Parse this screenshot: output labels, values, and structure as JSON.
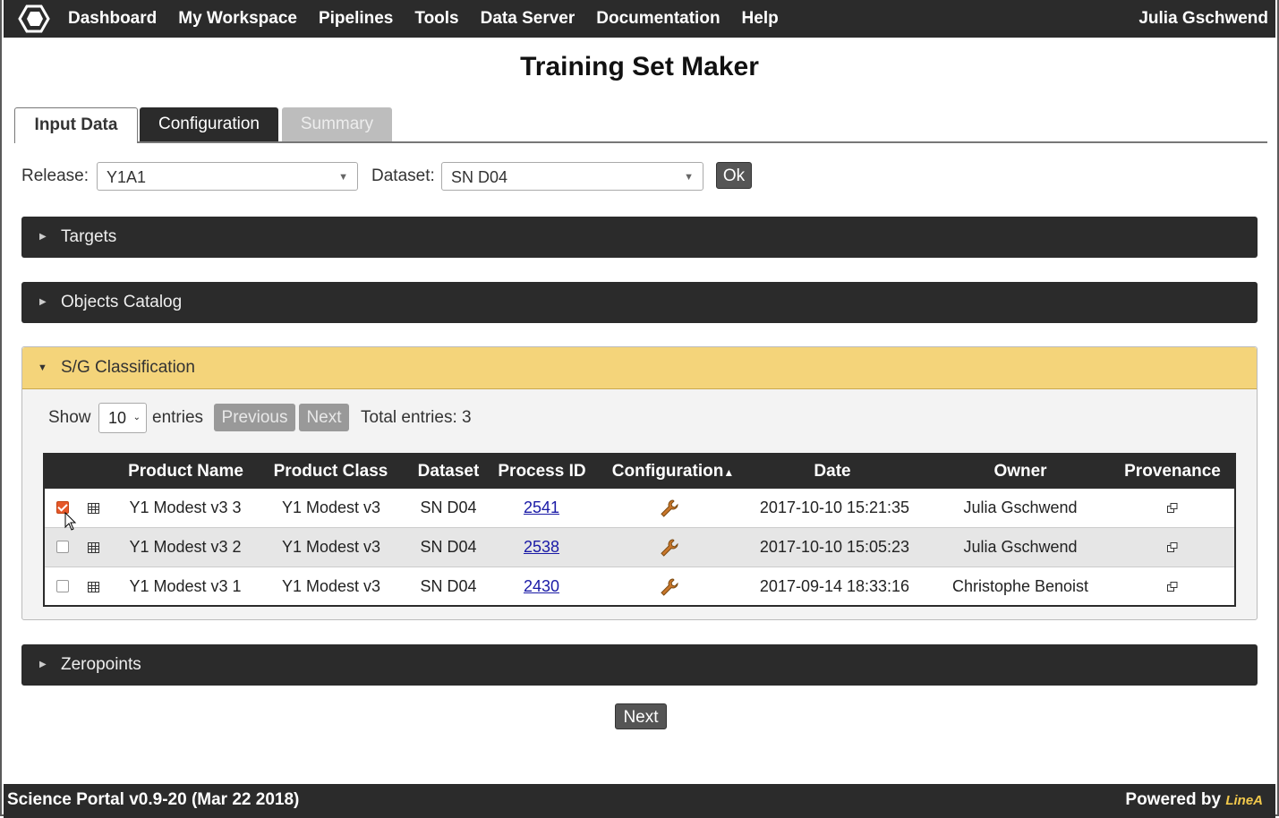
{
  "nav": {
    "items": [
      "Dashboard",
      "My Workspace",
      "Pipelines",
      "Tools",
      "Data Server",
      "Documentation",
      "Help"
    ],
    "user": "Julia Gschwend"
  },
  "page": {
    "title": "Training Set Maker"
  },
  "tabs": {
    "input": "Input Data",
    "config": "Configuration",
    "summary": "Summary"
  },
  "release": {
    "label": "Release:",
    "value": "Y1A1"
  },
  "dataset": {
    "label": "Dataset:",
    "value": "SN D04"
  },
  "ok_label": "Ok",
  "panels": {
    "targets": "Targets",
    "objects": "Objects Catalog",
    "sg": "S/G Classification",
    "zeropoints": "Zeropoints"
  },
  "table_controls": {
    "show": "Show",
    "page_size": "10",
    "entries": "entries",
    "previous": "Previous",
    "next": "Next",
    "total": "Total entries: 3"
  },
  "table": {
    "headers": [
      "Product Name",
      "Product Class",
      "Dataset",
      "Process ID",
      "Configuration",
      "Date",
      "Owner",
      "Provenance"
    ],
    "rows": [
      {
        "checked": true,
        "name": "Y1 Modest v3 3",
        "class": "Y1 Modest v3",
        "dataset": "SN D04",
        "pid": "2541",
        "date": "2017-10-10 15:21:35",
        "owner": "Julia Gschwend"
      },
      {
        "checked": false,
        "name": "Y1 Modest v3 2",
        "class": "Y1 Modest v3",
        "dataset": "SN D04",
        "pid": "2538",
        "date": "2017-10-10 15:05:23",
        "owner": "Julia Gschwend"
      },
      {
        "checked": false,
        "name": "Y1 Modest v3 1",
        "class": "Y1 Modest v3",
        "dataset": "SN D04",
        "pid": "2430",
        "date": "2017-09-14 18:33:16",
        "owner": "Christophe Benoist"
      }
    ]
  },
  "next_label": "Next",
  "footer": {
    "version": "Science Portal v0.9-20 (Mar 22 2018)",
    "powered": "Powered by",
    "brand": "LineA"
  },
  "colors": {
    "navbar": "#2b2b2b",
    "accent_panel": "#f4d47a",
    "checkbox_on": "#e5582a",
    "link": "#1a1aa6"
  }
}
